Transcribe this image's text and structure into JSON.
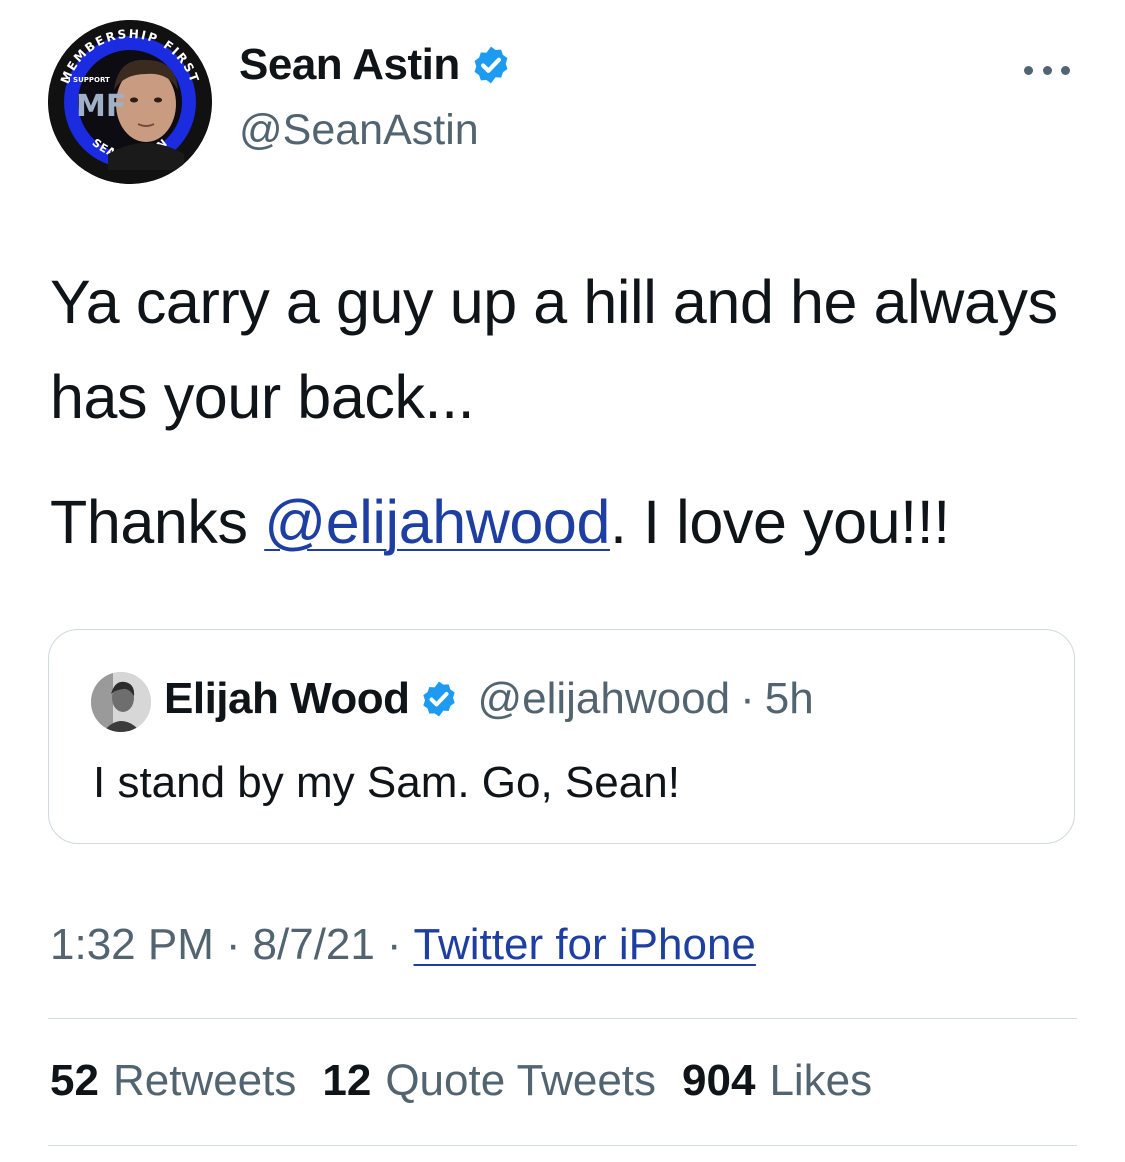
{
  "author": {
    "name": "Sean Astin",
    "handle": "@SeanAstin",
    "avatar_badge": {
      "top_text": "MEMBERSHIP FIRST",
      "bottom_text": "SEAN ASTIN",
      "support_text": "I SUPPORT",
      "letters": "MF",
      "ring_color": "#1b2be0"
    }
  },
  "tweet": {
    "line1": "Ya carry a guy up a hill and he always has your back...",
    "thanks_prefix": "Thanks ",
    "mention": "@elijahwood",
    "thanks_suffix": ". I love you!!!"
  },
  "quoted": {
    "name": "Elijah Wood",
    "handle": "@elijahwood",
    "separator": "·",
    "time": "5h",
    "text": "I stand by my Sam. Go, Sean!"
  },
  "meta": {
    "time": "1:32 PM",
    "separator": "·",
    "date": "8/7/21",
    "source": "Twitter for iPhone"
  },
  "stats": {
    "retweets_count": "52",
    "retweets_label": "Retweets",
    "quotes_count": "12",
    "quotes_label": "Quote Tweets",
    "likes_count": "904",
    "likes_label": "Likes"
  },
  "colors": {
    "link": "#1d3fa1",
    "verified": "#1d9bf0",
    "secondary_text": "#536471"
  },
  "icons": {
    "verified": "verified-badge-icon",
    "more": "more-horizontal-icon"
  }
}
